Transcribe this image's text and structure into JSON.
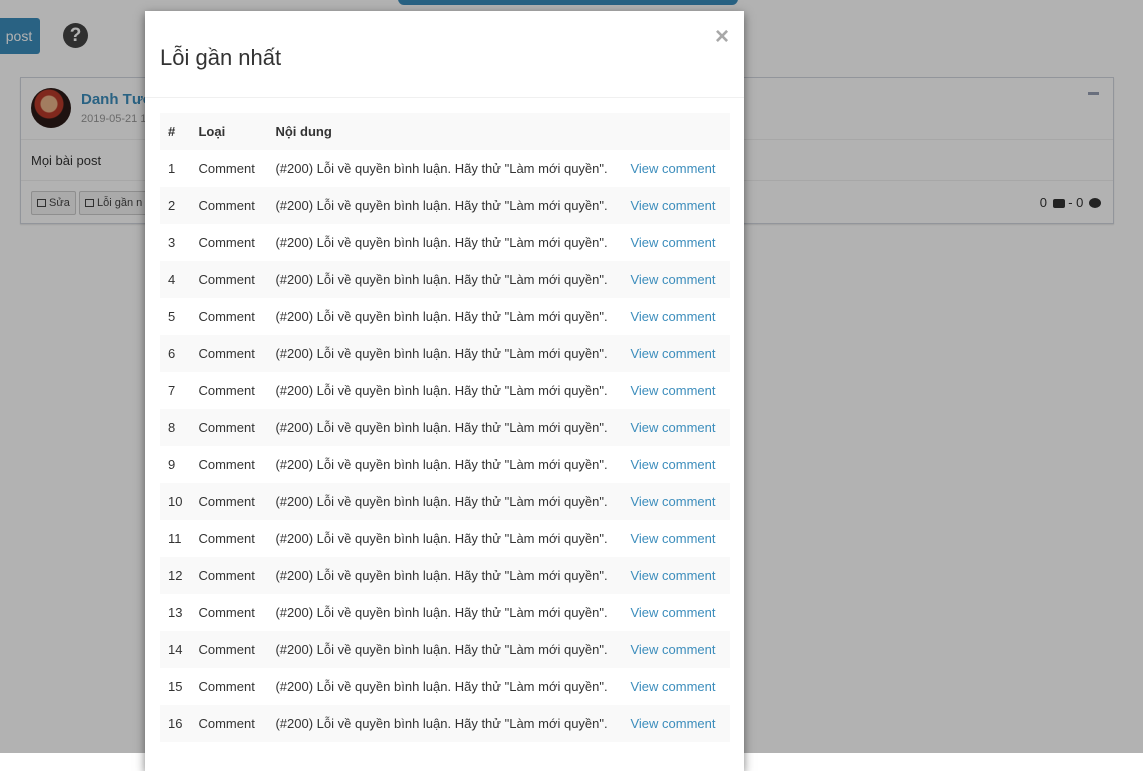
{
  "background": {
    "post_button_label": "post",
    "help_icon_glyph": "?",
    "card": {
      "user_name": "Danh Tướ",
      "date": "2019-05-21 1",
      "content": "Mọi bài post",
      "edit_label": "Sửa",
      "errors_label": "Lỗi gần n",
      "stats_left": "0",
      "stats_right": "- 0"
    }
  },
  "modal": {
    "title": "Lỗi gần nhất",
    "close_glyph": "×",
    "headers": [
      "#",
      "Loại",
      "Nội dung",
      ""
    ],
    "rows": [
      {
        "num": "1",
        "type": "Comment",
        "message": "(#200) Lỗi về quyền bình luận. Hãy thử \"Làm mới quyền\".",
        "link": "View comment"
      },
      {
        "num": "2",
        "type": "Comment",
        "message": "(#200) Lỗi về quyền bình luận. Hãy thử \"Làm mới quyền\".",
        "link": "View comment"
      },
      {
        "num": "3",
        "type": "Comment",
        "message": "(#200) Lỗi về quyền bình luận. Hãy thử \"Làm mới quyền\".",
        "link": "View comment"
      },
      {
        "num": "4",
        "type": "Comment",
        "message": "(#200) Lỗi về quyền bình luận. Hãy thử \"Làm mới quyền\".",
        "link": "View comment"
      },
      {
        "num": "5",
        "type": "Comment",
        "message": "(#200) Lỗi về quyền bình luận. Hãy thử \"Làm mới quyền\".",
        "link": "View comment"
      },
      {
        "num": "6",
        "type": "Comment",
        "message": "(#200) Lỗi về quyền bình luận. Hãy thử \"Làm mới quyền\".",
        "link": "View comment"
      },
      {
        "num": "7",
        "type": "Comment",
        "message": "(#200) Lỗi về quyền bình luận. Hãy thử \"Làm mới quyền\".",
        "link": "View comment"
      },
      {
        "num": "8",
        "type": "Comment",
        "message": "(#200) Lỗi về quyền bình luận. Hãy thử \"Làm mới quyền\".",
        "link": "View comment"
      },
      {
        "num": "9",
        "type": "Comment",
        "message": "(#200) Lỗi về quyền bình luận. Hãy thử \"Làm mới quyền\".",
        "link": "View comment"
      },
      {
        "num": "10",
        "type": "Comment",
        "message": "(#200) Lỗi về quyền bình luận. Hãy thử \"Làm mới quyền\".",
        "link": "View comment"
      },
      {
        "num": "11",
        "type": "Comment",
        "message": "(#200) Lỗi về quyền bình luận. Hãy thử \"Làm mới quyền\".",
        "link": "View comment"
      },
      {
        "num": "12",
        "type": "Comment",
        "message": "(#200) Lỗi về quyền bình luận. Hãy thử \"Làm mới quyền\".",
        "link": "View comment"
      },
      {
        "num": "13",
        "type": "Comment",
        "message": "(#200) Lỗi về quyền bình luận. Hãy thử \"Làm mới quyền\".",
        "link": "View comment"
      },
      {
        "num": "14",
        "type": "Comment",
        "message": "(#200) Lỗi về quyền bình luận. Hãy thử \"Làm mới quyền\".",
        "link": "View comment"
      },
      {
        "num": "15",
        "type": "Comment",
        "message": "(#200) Lỗi về quyền bình luận. Hãy thử \"Làm mới quyền\".",
        "link": "View comment"
      },
      {
        "num": "16",
        "type": "Comment",
        "message": "(#200) Lỗi về quyền bình luận. Hãy thử \"Làm mới quyền\".",
        "link": "View comment"
      }
    ]
  },
  "colors": {
    "accent": "#3c8dbc",
    "overlay": "rgba(0,0,0,0.3)"
  }
}
